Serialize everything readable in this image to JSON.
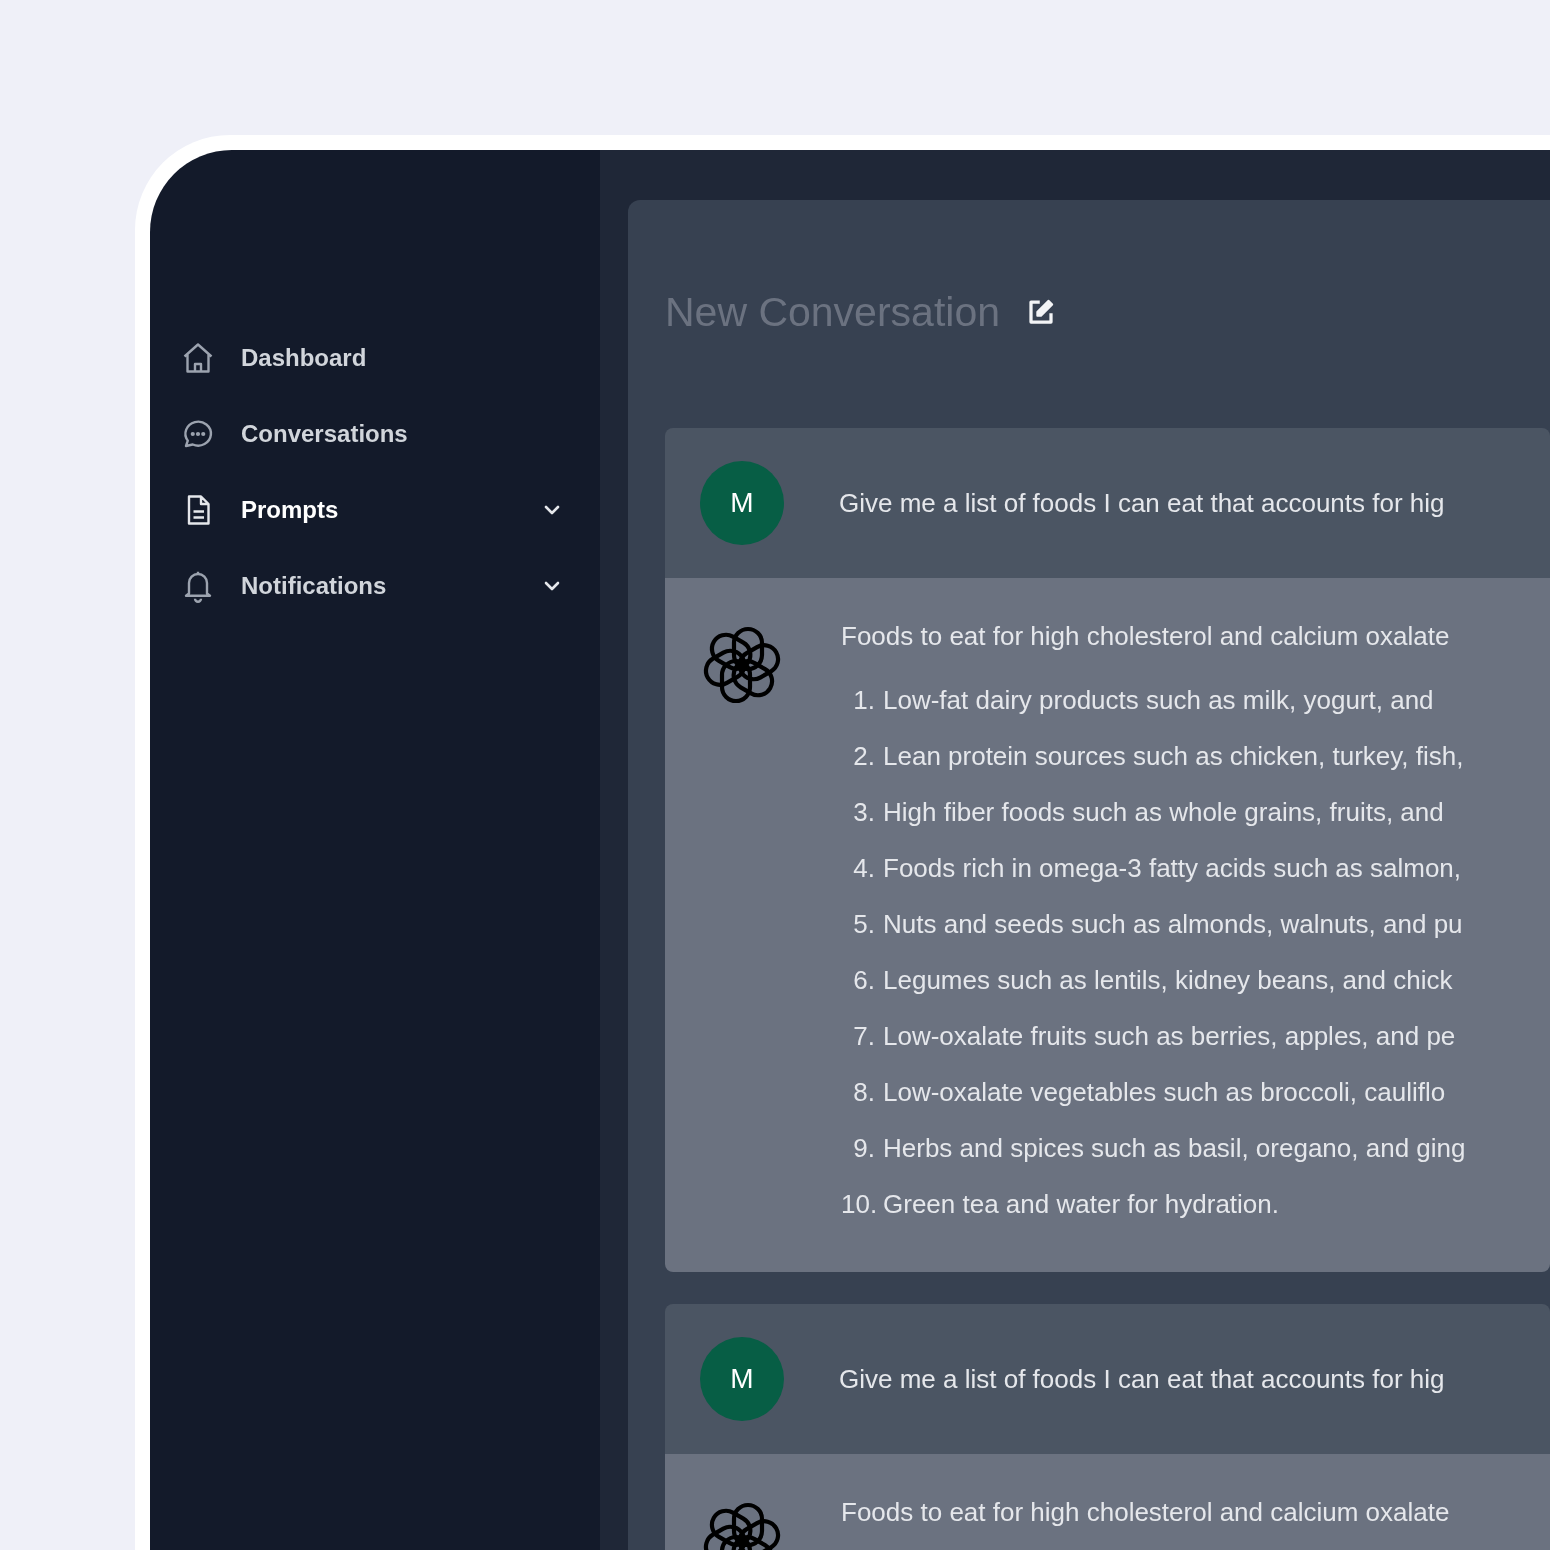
{
  "sidebar": {
    "items": [
      {
        "label": "Dashboard",
        "selected": false,
        "expandable": false
      },
      {
        "label": "Conversations",
        "selected": false,
        "expandable": false
      },
      {
        "label": "Prompts",
        "selected": true,
        "expandable": true
      },
      {
        "label": "Notifications",
        "selected": false,
        "expandable": true
      }
    ]
  },
  "conversation": {
    "title": "New Conversation",
    "messages": [
      {
        "user": {
          "avatar": "M",
          "text": "Give me a list of foods I can eat that accounts for hig"
        },
        "assistant": {
          "intro": "Foods to eat for high cholesterol and calcium oxalate",
          "items": [
            {
              "number": "1.",
              "text": "Low-fat dairy products such as milk, yogurt, and"
            },
            {
              "number": "2.",
              "text": "Lean protein sources such as chicken, turkey, fish,"
            },
            {
              "number": "3.",
              "text": "High fiber foods such as whole grains, fruits, and"
            },
            {
              "number": "4.",
              "text": "Foods rich in omega-3 fatty acids such as salmon,"
            },
            {
              "number": "5.",
              "text": "Nuts and seeds such as almonds, walnuts, and pu"
            },
            {
              "number": "6.",
              "text": "Legumes such as lentils, kidney beans, and chick"
            },
            {
              "number": "7.",
              "text": "Low-oxalate fruits such as berries, apples, and pe"
            },
            {
              "number": "8.",
              "text": "Low-oxalate vegetables such as broccoli, cauliflo"
            },
            {
              "number": "9.",
              "text": "Herbs and spices such as basil, oregano, and ging"
            },
            {
              "number": "10.",
              "text": "Green tea and water for hydration."
            }
          ]
        }
      },
      {
        "user": {
          "avatar": "M",
          "text": "Give me a list of foods I can eat that accounts for hig"
        },
        "assistant": {
          "intro": "Foods to eat for high cholesterol and calcium oxalate"
        }
      }
    ]
  }
}
